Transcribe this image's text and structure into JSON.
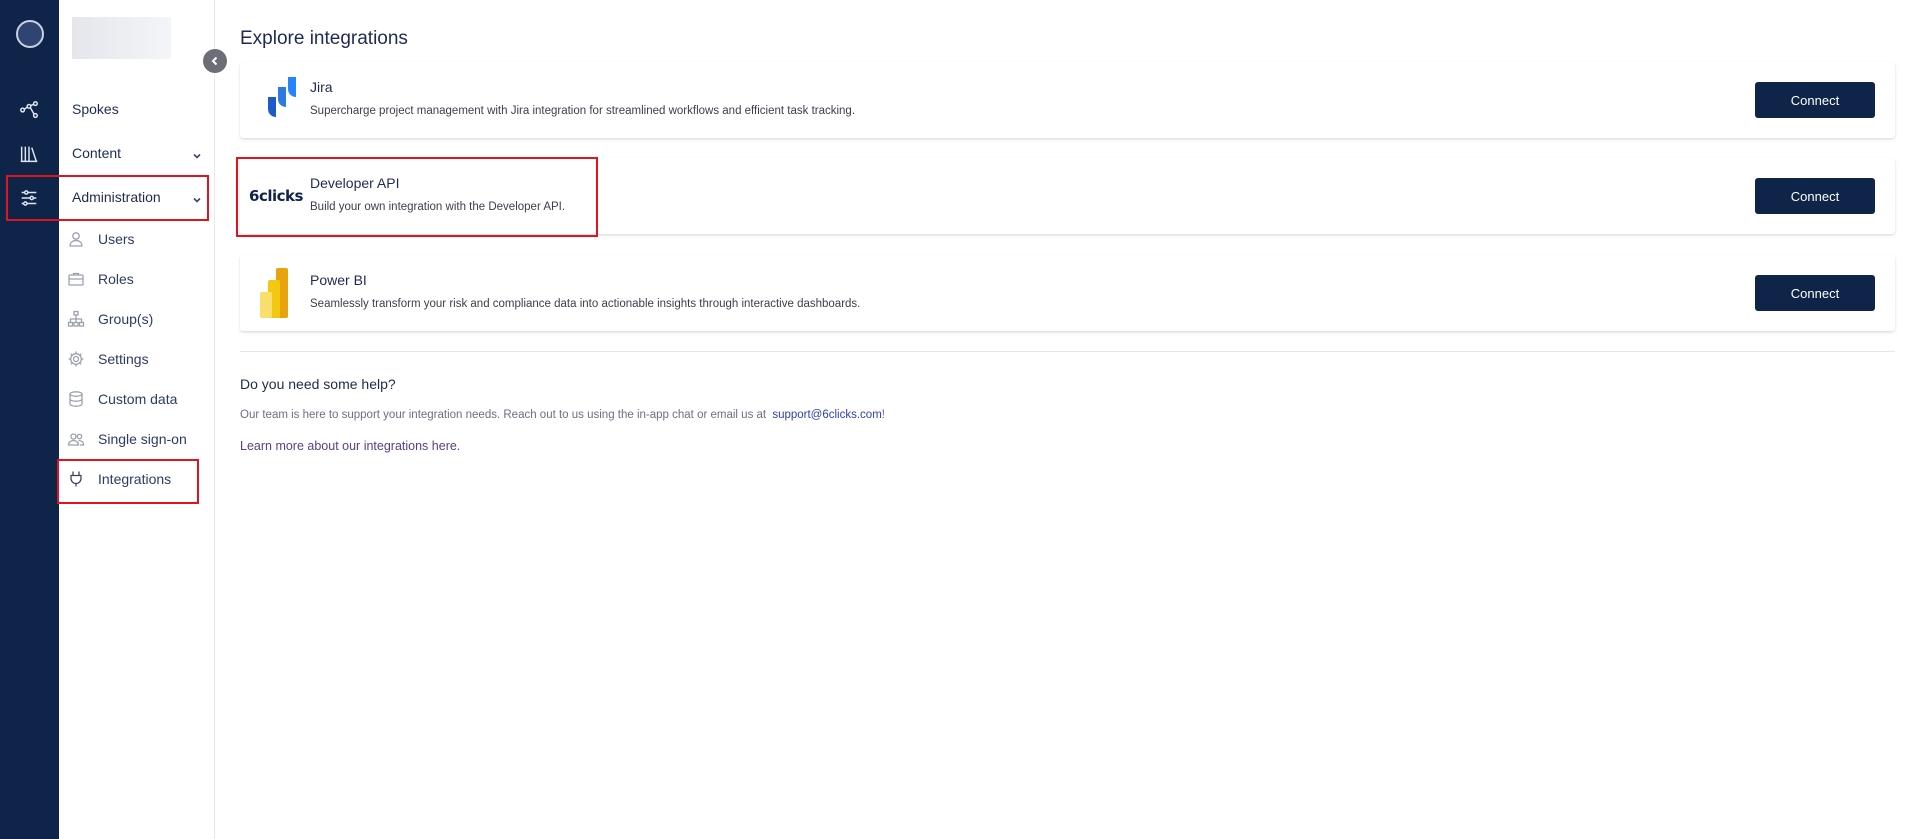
{
  "rail": {
    "icons": [
      "network-icon",
      "library-icon",
      "sliders-icon"
    ]
  },
  "sidebar": {
    "spokes": "Spokes",
    "content": "Content",
    "administration": "Administration",
    "sub_items": [
      {
        "label": "Users",
        "icon": "user-icon"
      },
      {
        "label": "Roles",
        "icon": "briefcase-icon"
      },
      {
        "label": "Group(s)",
        "icon": "hierarchy-icon"
      },
      {
        "label": "Settings",
        "icon": "gear-icon"
      },
      {
        "label": "Custom data",
        "icon": "database-icon"
      },
      {
        "label": "Single sign-on",
        "icon": "users-icon"
      },
      {
        "label": "Integrations",
        "icon": "plug-icon"
      }
    ]
  },
  "main": {
    "title": "Explore integrations",
    "integrations": [
      {
        "name": "Jira",
        "description": "Supercharge project management with Jira integration for streamlined workflows and efficient task tracking.",
        "button": "Connect"
      },
      {
        "name": "Developer API",
        "logo_text": "6clicks",
        "description": "Build your own integration with the Developer API.",
        "button": "Connect"
      },
      {
        "name": "Power BI",
        "description": "Seamlessly transform your risk and compliance data into actionable insights through interactive dashboards.",
        "button": "Connect"
      }
    ],
    "help": {
      "title": "Do you need some help?",
      "text": "Our team is here to support your integration needs. Reach out to us using the in-app chat or email us at",
      "email": "support@6clicks.com",
      "email_suffix": "!",
      "learn_more": "Learn more about our integrations here."
    }
  },
  "colors": {
    "rail_bg": "#0e2448",
    "button_bg": "#0e2448",
    "highlight": "#e0141e",
    "jira_blue": "#2684ff",
    "powerbi_yellow": "#f2c811"
  }
}
